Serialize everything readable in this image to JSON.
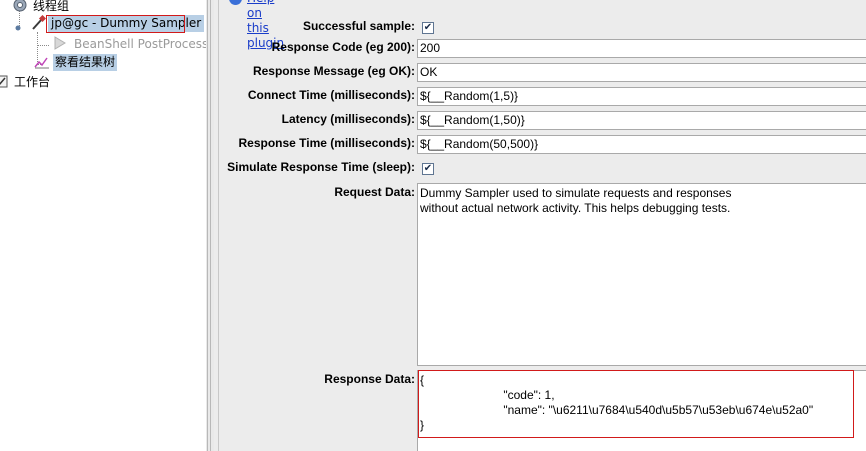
{
  "tree": {
    "thread_group": "线程组",
    "sampler": "jp@gc - Dummy Sampler",
    "postprocessor": "BeanShell PostProcess",
    "result_tree": "察看结果树",
    "workbench": "工作台"
  },
  "form": {
    "help_link": "Help on this plugin",
    "successful_sample_label": "Successful sample:",
    "successful_sample_checked": "✔",
    "response_code_label": "Response Code (eg 200):",
    "response_code_value": "200",
    "response_message_label": "Response Message (eg OK):",
    "response_message_value": "OK",
    "connect_time_label": "Connect Time (milliseconds):",
    "connect_time_value": "${__Random(1,5)}",
    "latency_label": "Latency (milliseconds):",
    "latency_value": "${__Random(1,50)}",
    "response_time_label": "Response Time (milliseconds):",
    "response_time_value": "${__Random(50,500)}",
    "simulate_label": "Simulate Response Time (sleep):",
    "simulate_checked": "✔",
    "request_data_label": "Request Data:",
    "request_data_value": "Dummy Sampler used to simulate requests and responses\nwithout actual network activity. This helps debugging tests.",
    "response_data_label": "Response Data:",
    "response_data_value": "{\n                         \"code\": 1,\n                         \"name\": \"\\u6211\\u7684\\u540d\\u5b57\\u53eb\\u674e\\u52a0\"\n}"
  },
  "colors": {
    "highlight_red": "#d11a1a",
    "selection_blue": "#b8cfe5",
    "panel_bg": "#ececec",
    "link_blue": "#1a3dc9"
  }
}
